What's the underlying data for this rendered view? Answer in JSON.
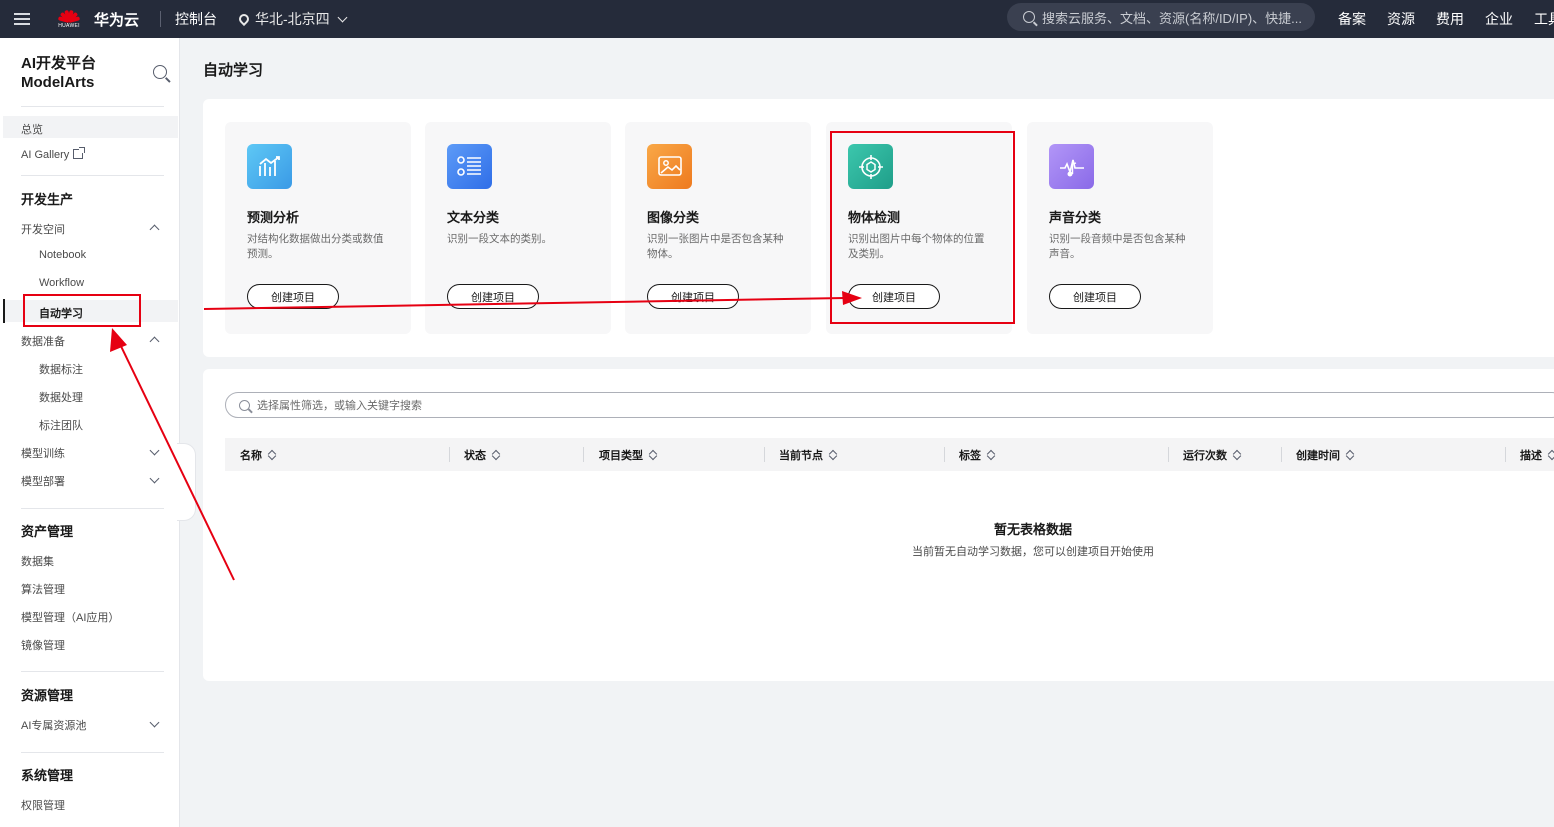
{
  "topbar": {
    "logo_text": "华为云",
    "logo_sub": "HUAWEI",
    "console": "控制台",
    "region": "华北-北京四",
    "search_placeholder": "搜索云服务、文档、资源(名称/ID/IP)、快捷...",
    "nav": [
      "备案",
      "资源",
      "费用",
      "企业",
      "工具"
    ],
    "bg_color": "#252b3a"
  },
  "sidebar": {
    "brand_line1": "AI开发平台",
    "brand_line2": "ModelArts",
    "overview": "总览",
    "gallery": "AI Gallery",
    "section_dev": "开发生产",
    "dev_space": "开发空间",
    "notebook": "Notebook",
    "workflow": "Workflow",
    "automl": "自动学习",
    "data_prep": "数据准备",
    "data_label": "数据标注",
    "data_process": "数据处理",
    "label_team": "标注团队",
    "model_train": "模型训练",
    "model_deploy": "模型部署",
    "section_assets": "资产管理",
    "datasets": "数据集",
    "algorithms": "算法管理",
    "models": "模型管理（AI应用）",
    "images": "镜像管理",
    "section_resources": "资源管理",
    "pools": "AI专属资源池",
    "section_system": "系统管理",
    "permissions": "权限管理"
  },
  "main": {
    "title": "自动学习",
    "cards": [
      {
        "title": "预测分析",
        "desc": "对结构化数据做出分类或数值预测。",
        "button": "创建项目",
        "icon": "chart-icon",
        "color": "#4fb4ef"
      },
      {
        "title": "文本分类",
        "desc": "识别一段文本的类别。",
        "button": "创建项目",
        "icon": "list-icon",
        "color": "#3d7ff0"
      },
      {
        "title": "图像分类",
        "desc": "识别一张图片中是否包含某种物体。",
        "button": "创建项目",
        "icon": "image-icon",
        "color": "#f58a2d"
      },
      {
        "title": "物体检测",
        "desc": "识别出图片中每个物体的位置及类别。",
        "button": "创建项目",
        "icon": "target-icon",
        "color": "#29b39c"
      },
      {
        "title": "声音分类",
        "desc": "识别一段音频中是否包含某种声音。",
        "button": "创建项目",
        "icon": "sound-icon",
        "color": "#9b7cf0"
      }
    ],
    "filter_placeholder": "选择属性筛选，或输入关键字搜索",
    "columns": [
      "名称",
      "状态",
      "项目类型",
      "当前节点",
      "标签",
      "运行次数",
      "创建时间",
      "描述"
    ],
    "empty_title": "暂无表格数据",
    "empty_sub": "当前暂无自动学习数据，您可以创建项目开始使用"
  },
  "annotation_color": "#e60012"
}
